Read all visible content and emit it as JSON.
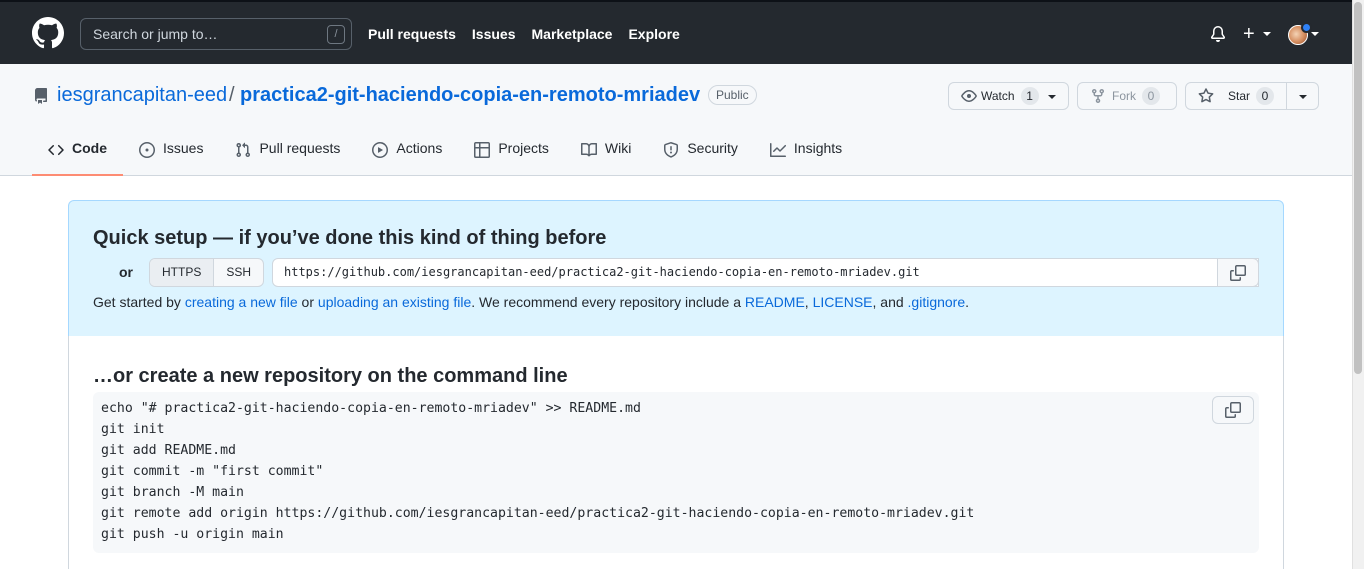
{
  "header": {
    "search_placeholder": "Search or jump to…",
    "search_shortcut": "/",
    "nav": [
      "Pull requests",
      "Issues",
      "Marketplace",
      "Explore"
    ],
    "plus_label": "+"
  },
  "repo": {
    "owner": "iesgrancapitan-eed",
    "separator": "/",
    "name": "practica2-git-haciendo-copia-en-remoto-mriadev",
    "visibility": "Public",
    "watch_label": "Watch",
    "watch_count": "1",
    "fork_label": "Fork",
    "fork_count": "0",
    "star_label": "Star",
    "star_count": "0"
  },
  "tabs": [
    {
      "label": "Code",
      "icon": "code-icon",
      "active": true
    },
    {
      "label": "Issues",
      "icon": "issue-icon"
    },
    {
      "label": "Pull requests",
      "icon": "pull-request-icon"
    },
    {
      "label": "Actions",
      "icon": "play-icon"
    },
    {
      "label": "Projects",
      "icon": "table-icon"
    },
    {
      "label": "Wiki",
      "icon": "book-icon"
    },
    {
      "label": "Security",
      "icon": "shield-icon"
    },
    {
      "label": "Insights",
      "icon": "graph-icon"
    }
  ],
  "quick_setup": {
    "title": "Quick setup — if you’ve done this kind of thing before",
    "or": "or",
    "https": "HTTPS",
    "ssh": "SSH",
    "url": "https://github.com/iesgrancapitan-eed/practica2-git-haciendo-copia-en-remoto-mriadev.git",
    "text_1": "Get started by ",
    "link_new_file": "creating a new file",
    "text_2": " or ",
    "link_upload": "uploading an existing file",
    "text_3": ". We recommend every repository include a ",
    "link_readme": "README",
    "text_4": ", ",
    "link_license": "LICENSE",
    "text_5": ", and ",
    "link_gitignore": ".gitignore",
    "text_6": "."
  },
  "command_line": {
    "title": "…or create a new repository on the command line",
    "lines": [
      "echo \"# practica2-git-haciendo-copia-en-remoto-mriadev\" >> README.md",
      "git init",
      "git add README.md",
      "git commit -m \"first commit\"",
      "git branch -M main",
      "git remote add origin https://github.com/iesgrancapitan-eed/practica2-git-haciendo-copia-en-remoto-mriadev.git",
      "git push -u origin main"
    ]
  },
  "colors": {
    "header_bg": "#24292f",
    "link": "#0969da",
    "quick_setup_bg": "#ddf4ff",
    "active_tab_underline": "#fd8c73",
    "notification_dot": "#2f81f7"
  }
}
